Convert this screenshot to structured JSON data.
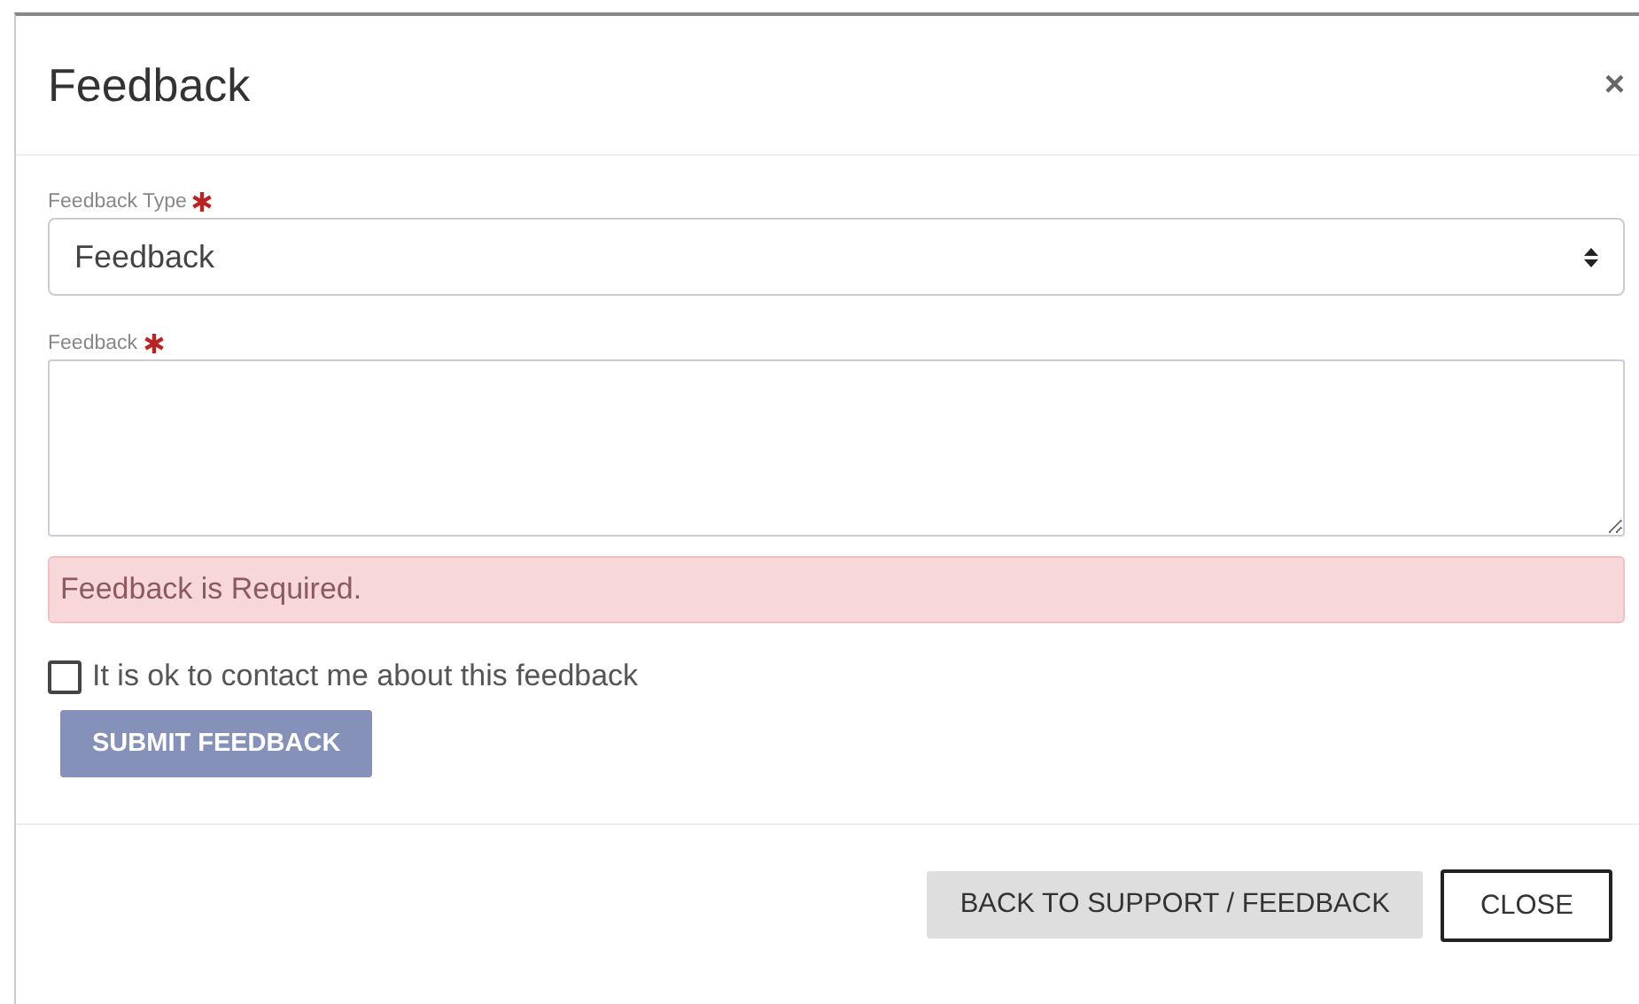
{
  "dialog": {
    "title": "Feedback",
    "close_label": "×"
  },
  "fields": [
    {
      "kind": "select",
      "label": "Feedback Type",
      "required": true,
      "value": "Feedback"
    },
    {
      "kind": "textarea",
      "label": "Feedback",
      "required": true
    }
  ],
  "alert": {
    "text": "Feedback is Required."
  },
  "contact_checkbox": {
    "label": "It is ok to contact me about this feedback",
    "checked": false
  },
  "submit_button": {
    "label": "SUBMIT FEEDBACK",
    "disabled": true
  },
  "footer_buttons": [
    {
      "kind": "secondary",
      "label": "BACK TO SUPPORT / FEEDBACK"
    },
    {
      "kind": "outline",
      "label": "CLOSE"
    }
  ]
}
